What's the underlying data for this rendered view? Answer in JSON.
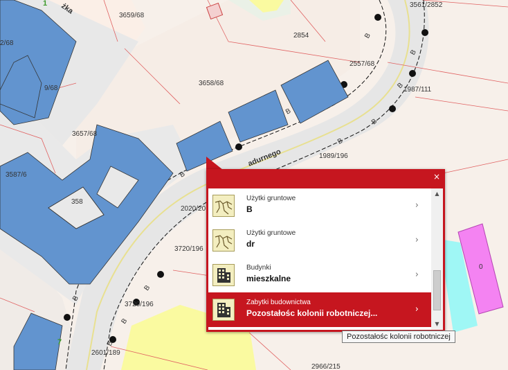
{
  "map": {
    "street_name_fragment_1": "żka",
    "street_name_fragment_2": "adurnego",
    "parcels": [
      "3659/68",
      "2854",
      "2557/68",
      "3658/68",
      "1987/111",
      "3657/68",
      "1989/196",
      "3587/6",
      "358",
      "2020/20",
      "3720/196",
      "3720/196",
      "2601/189",
      "2966/215",
      "3561/2852",
      "2/68",
      "9/68"
    ],
    "symbols": {
      "land_use_b": "B",
      "green_1": "1",
      "green_7": "7",
      "zero": "0"
    }
  },
  "popup": {
    "close_label": "×",
    "items": [
      {
        "category": "Użytki gruntowe",
        "value": "B",
        "icon": "land-use-icon"
      },
      {
        "category": "Użytki gruntowe",
        "value": "dr",
        "icon": "land-use-icon"
      },
      {
        "category": "Budynki",
        "value": "mieszkalne",
        "icon": "building-icon"
      },
      {
        "category": "Zabytki budownictwa",
        "value": "Pozostałośc kolonii robotniczej...",
        "icon": "building-icon"
      }
    ],
    "chevron": "›",
    "scroll_up": "▲",
    "scroll_down": "▼"
  },
  "tooltip": {
    "text": "Pozostałośc kolonii robotniczej"
  },
  "colors": {
    "accent": "#c6161f",
    "building": "#6294cf",
    "yellow_zone": "#fafaa0",
    "pink_zone": "#f483f2",
    "cyan_zone": "#9ff7f5"
  }
}
